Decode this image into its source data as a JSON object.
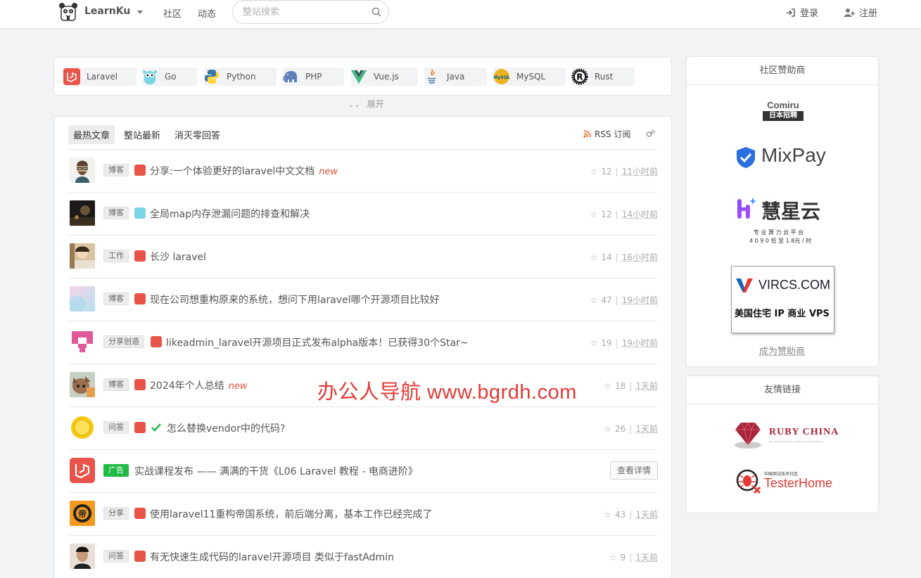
{
  "nav": {
    "brand": "LearnKu",
    "links": [
      "社区",
      "动态"
    ],
    "search_placeholder": "整站搜索",
    "login": "登录",
    "signup": "注册"
  },
  "topics": [
    {
      "label": "Laravel",
      "icon": "laravel-icon",
      "color": "#e8544a"
    },
    {
      "label": "Go",
      "icon": "gopher-icon",
      "color": "#79d4e5"
    },
    {
      "label": "Python",
      "icon": "python-icon",
      "color": "#3776ab"
    },
    {
      "label": "PHP",
      "icon": "elephpant-icon",
      "color": "#5f7fb8"
    },
    {
      "label": "Vue.js",
      "icon": "vue-icon",
      "color": "#41b883"
    },
    {
      "label": "Java",
      "icon": "java-icon",
      "color": "#e76f00"
    },
    {
      "label": "MySQL",
      "icon": "mysql-icon",
      "color": "#f0b323"
    },
    {
      "label": "Rust",
      "icon": "rust-icon",
      "color": "#000000"
    }
  ],
  "expand_label": "展开",
  "feed": {
    "tabs": [
      "最热文章",
      "整站最新",
      "消灭零回答"
    ],
    "rss": "RSS 订阅",
    "articles": [
      {
        "category": "博客",
        "title": "分享:一个体验更好的laravel中文文档",
        "new": "new",
        "stars": "12",
        "time": "11小时前",
        "node": "laravel"
      },
      {
        "category": "博客",
        "title": "全局map内存泄漏问题的排查和解决",
        "new": "",
        "stars": "12",
        "time": "14小时前",
        "node": "go"
      },
      {
        "category": "工作",
        "title": "长沙 laravel",
        "new": "",
        "stars": "14",
        "time": "16小时前",
        "node": "laravel"
      },
      {
        "category": "博客",
        "title": "现在公司想重构原来的系统，想问下用laravel哪个开源项目比较好",
        "new": "",
        "stars": "47",
        "time": "19小时前",
        "node": "laravel"
      },
      {
        "category": "分享创造",
        "title": "likeadmin_laravel开源项目正式发布alpha版本！已获得30个Star~",
        "new": "",
        "stars": "19",
        "time": "19小时前",
        "node": "laravel"
      },
      {
        "category": "博客",
        "title": "2024年个人总结",
        "new": "new",
        "stars": "18",
        "time": "1天前",
        "node": "laravel"
      },
      {
        "category": "问答",
        "title": "怎么替换vendor中的代码?",
        "new": "",
        "stars": "26",
        "time": "1天前",
        "node": "laravel"
      },
      {
        "category": "广告",
        "title": "实战课程发布 —— 满满的干货《L06 Laravel 教程 - 电商进阶》",
        "new": "",
        "button": "查看详情",
        "node": ""
      },
      {
        "category": "分享",
        "title": "使用laravel11重构帝国系统，前后端分离，基本工作已经完成了",
        "new": "",
        "stars": "43",
        "time": "1天前",
        "node": "laravel"
      },
      {
        "category": "问答",
        "title": "有无快速生成代码的laravel开源项目 类似于fastAdmin",
        "new": "",
        "stars": "9",
        "time": "1天前",
        "node": "laravel"
      }
    ]
  },
  "watermark": "办公人导航 www.bgrdh.com",
  "sidebar": {
    "sponsors_title": "社区赞助商",
    "sponsors": {
      "comiru": {
        "name": "Comiru",
        "sub": "日本招聘"
      },
      "mixpay": {
        "name": "MixPay"
      },
      "huixingyun": {
        "name": "慧星云",
        "line1": "专 业 算 力 云 平 台",
        "line2": "4 0 9 0 低 至 1.8元 / 时"
      },
      "vircs": {
        "name": "VIRCS.COM",
        "sub": "美国住宅 IP 商业 VPS"
      }
    },
    "become_sponsor": "成为赞助商",
    "friends_title": "友情链接",
    "friends": {
      "rubychina": {
        "name": "RUBY CHINA",
        "sub": "We are the China Ruby & Rails community Network"
      },
      "testerhome": {
        "name": "TesterHome",
        "sub": "中国测试技术社区"
      }
    }
  }
}
